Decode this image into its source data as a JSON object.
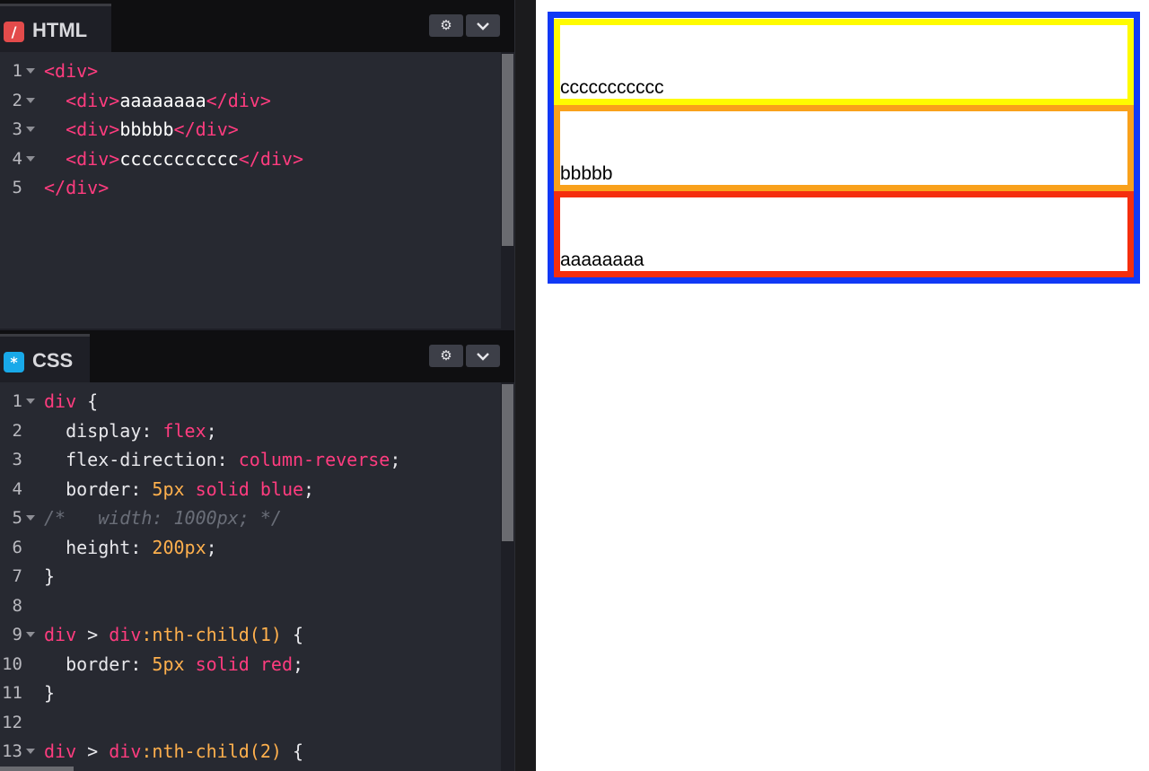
{
  "html_panel": {
    "icon": "/",
    "title": "HTML",
    "settings_icon": "gear-icon",
    "collapse_icon": "chevron-down-icon"
  },
  "css_panel": {
    "icon": "*",
    "title": "CSS",
    "settings_icon": "gear-icon",
    "collapse_icon": "chevron-down-icon"
  },
  "html_code": [
    {
      "num": "1",
      "fold": true,
      "tokens": [
        {
          "t": "<div>",
          "c": "tag"
        }
      ]
    },
    {
      "num": "2",
      "fold": true,
      "tokens": [
        {
          "t": "  ",
          "c": "text"
        },
        {
          "t": "<div>",
          "c": "tag"
        },
        {
          "t": "aaaaaaaa",
          "c": "text"
        },
        {
          "t": "</div>",
          "c": "tag"
        }
      ]
    },
    {
      "num": "3",
      "fold": true,
      "tokens": [
        {
          "t": "  ",
          "c": "text"
        },
        {
          "t": "<div>",
          "c": "tag"
        },
        {
          "t": "bbbbb",
          "c": "text"
        },
        {
          "t": "</div>",
          "c": "tag"
        }
      ]
    },
    {
      "num": "4",
      "fold": true,
      "tokens": [
        {
          "t": "  ",
          "c": "text"
        },
        {
          "t": "<div>",
          "c": "tag"
        },
        {
          "t": "ccccccccccc",
          "c": "text"
        },
        {
          "t": "</div>",
          "c": "tag"
        }
      ]
    },
    {
      "num": "5",
      "fold": false,
      "tokens": [
        {
          "t": "</div>",
          "c": "tag"
        }
      ]
    }
  ],
  "css_code": [
    {
      "num": "1",
      "fold": true,
      "tokens": [
        {
          "t": "div",
          "c": "sel"
        },
        {
          "t": " {",
          "c": "punc"
        }
      ]
    },
    {
      "num": "2",
      "fold": false,
      "tokens": [
        {
          "t": "  display",
          "c": "prop"
        },
        {
          "t": ": ",
          "c": "punc"
        },
        {
          "t": "flex",
          "c": "val"
        },
        {
          "t": ";",
          "c": "punc"
        }
      ]
    },
    {
      "num": "3",
      "fold": false,
      "tokens": [
        {
          "t": "  flex-direction",
          "c": "prop"
        },
        {
          "t": ": ",
          "c": "punc"
        },
        {
          "t": "column-reverse",
          "c": "val"
        },
        {
          "t": ";",
          "c": "punc"
        }
      ]
    },
    {
      "num": "4",
      "fold": false,
      "tokens": [
        {
          "t": "  border",
          "c": "prop"
        },
        {
          "t": ": ",
          "c": "punc"
        },
        {
          "t": "5px",
          "c": "num"
        },
        {
          "t": " ",
          "c": "punc"
        },
        {
          "t": "solid",
          "c": "val"
        },
        {
          "t": " ",
          "c": "punc"
        },
        {
          "t": "blue",
          "c": "val"
        },
        {
          "t": ";",
          "c": "punc"
        }
      ]
    },
    {
      "num": "5",
      "fold": true,
      "tokens": [
        {
          "t": "/*   width: 1000px; */",
          "c": "cmt"
        }
      ]
    },
    {
      "num": "6",
      "fold": false,
      "tokens": [
        {
          "t": "  height",
          "c": "prop"
        },
        {
          "t": ": ",
          "c": "punc"
        },
        {
          "t": "200px",
          "c": "num"
        },
        {
          "t": ";",
          "c": "punc"
        }
      ]
    },
    {
      "num": "7",
      "fold": false,
      "tokens": [
        {
          "t": "}",
          "c": "punc"
        }
      ]
    },
    {
      "num": "8",
      "fold": false,
      "tokens": []
    },
    {
      "num": "9",
      "fold": true,
      "tokens": [
        {
          "t": "div",
          "c": "sel"
        },
        {
          "t": " > ",
          "c": "punc"
        },
        {
          "t": "div",
          "c": "sel"
        },
        {
          "t": ":nth-child(",
          "c": "pseudo"
        },
        {
          "t": "1",
          "c": "num"
        },
        {
          "t": ")",
          "c": "pseudo"
        },
        {
          "t": " {",
          "c": "punc"
        }
      ]
    },
    {
      "num": "10",
      "fold": false,
      "tokens": [
        {
          "t": "  border",
          "c": "prop"
        },
        {
          "t": ": ",
          "c": "punc"
        },
        {
          "t": "5px",
          "c": "num"
        },
        {
          "t": " ",
          "c": "punc"
        },
        {
          "t": "solid",
          "c": "val"
        },
        {
          "t": " ",
          "c": "punc"
        },
        {
          "t": "red",
          "c": "val"
        },
        {
          "t": ";",
          "c": "punc"
        }
      ]
    },
    {
      "num": "11",
      "fold": false,
      "tokens": [
        {
          "t": "}",
          "c": "punc"
        }
      ]
    },
    {
      "num": "12",
      "fold": false,
      "tokens": []
    },
    {
      "num": "13",
      "fold": true,
      "tokens": [
        {
          "t": "div",
          "c": "sel"
        },
        {
          "t": " > ",
          "c": "punc"
        },
        {
          "t": "div",
          "c": "sel"
        },
        {
          "t": ":nth-child(",
          "c": "pseudo"
        },
        {
          "t": "2",
          "c": "num"
        },
        {
          "t": ")",
          "c": "pseudo"
        },
        {
          "t": " {",
          "c": "punc"
        }
      ]
    }
  ],
  "preview": {
    "child_a": "aaaaaaaa",
    "child_b": "bbbbb",
    "child_c": "ccccccccccc",
    "colors": {
      "outer": "#1139f5",
      "child_a": "#f52e0e",
      "child_b": "#f9a11b",
      "child_c": "#fffb00"
    }
  }
}
